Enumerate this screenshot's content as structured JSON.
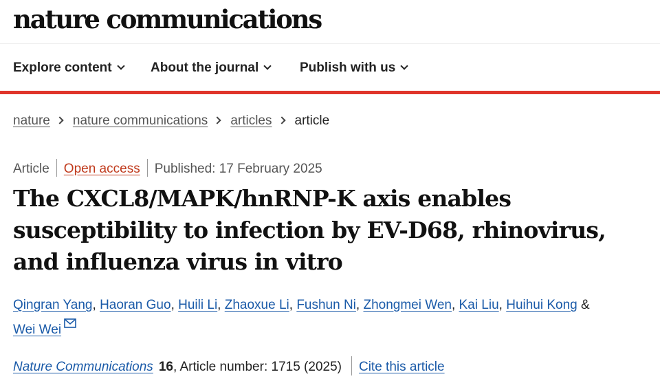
{
  "site": {
    "logo": "nature communications"
  },
  "nav": {
    "items": [
      {
        "label": "Explore content",
        "icon": "chevron-down-icon"
      },
      {
        "label": "About the journal",
        "icon": "chevron-down-icon"
      },
      {
        "label": "Publish with us",
        "icon": "chevron-down-icon"
      }
    ]
  },
  "breadcrumb": {
    "items": [
      "nature",
      "nature communications",
      "articles"
    ],
    "current": "article"
  },
  "meta": {
    "type": "Article",
    "access": "Open access",
    "published": "Published: 17 February 2025"
  },
  "article": {
    "title": "The CXCL8/MAPK/hnRNP-K axis enables susceptibility to infection by EV-D68, rhinovirus, and influenza virus in vitro",
    "authors": [
      "Qingran Yang",
      "Haoran Guo",
      "Huili Li",
      "Zhaoxue Li",
      "Fushun Ni",
      "Zhongmei Wen",
      "Kai Liu",
      "Huihui Kong",
      "Wei Wei"
    ],
    "author_separator": ", ",
    "author_last_joiner": " &",
    "corresponding_icon": "mail-icon"
  },
  "citation": {
    "journal": "Nature Communications",
    "volume": "16",
    "article_number": ", Article number: 1715 (2025)",
    "cite_label": "Cite this article"
  },
  "colors": {
    "accent_red": "#e0352b",
    "link_blue": "#1a5aa8",
    "open_access": "#c0391b"
  }
}
